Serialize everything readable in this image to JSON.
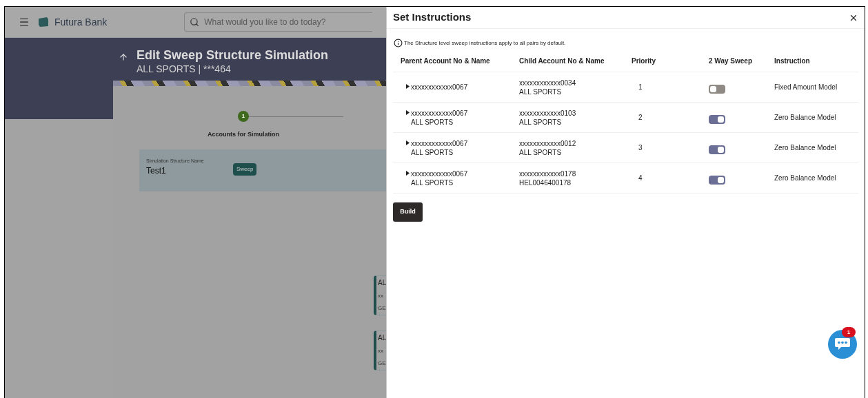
{
  "header": {
    "brand": "Futura Bank",
    "search": {
      "placeholder": "What would you like to do today?"
    }
  },
  "banner": {
    "title": "Edit Sweep Structure Simulation",
    "subtitle": "ALL SPORTS | ***464"
  },
  "stepper": {
    "step_number": "1",
    "step_label": "Accounts for Simulation"
  },
  "structure": {
    "label": "Simulation Structure Name",
    "value": "Test1",
    "tag": "Sweep"
  },
  "account_cards": [
    {
      "lines": [
        "AL",
        "xx",
        "GE"
      ]
    },
    {
      "lines": [
        "AL",
        "xx",
        "GE"
      ]
    }
  ],
  "dialog": {
    "title": "Set Instructions",
    "info": "The Structure level sweep instructions apply to all pairs by default.",
    "columns": [
      "Parent Account No & Name",
      "Child Account No & Name",
      "Priority",
      "2 Way Sweep",
      "Instruction"
    ],
    "rows": [
      {
        "parent": [
          "xxxxxxxxxxxx0067"
        ],
        "child": [
          "xxxxxxxxxxxx0034",
          "ALL SPORTS"
        ],
        "priority": "1",
        "two_way": false,
        "instruction": "Fixed Amount Model"
      },
      {
        "parent": [
          "xxxxxxxxxxxx0067",
          "ALL SPORTS"
        ],
        "child": [
          "xxxxxxxxxxxx0103",
          "ALL SPORTS"
        ],
        "priority": "2",
        "two_way": true,
        "instruction": "Zero Balance Model"
      },
      {
        "parent": [
          "xxxxxxxxxxxx0067",
          "ALL SPORTS"
        ],
        "child": [
          "xxxxxxxxxxxx0012",
          "ALL SPORTS"
        ],
        "priority": "3",
        "two_way": true,
        "instruction": "Zero Balance Model"
      },
      {
        "parent": [
          "xxxxxxxxxxxx0067",
          "ALL SPORTS"
        ],
        "child": [
          "xxxxxxxxxxxx0178",
          "HEL0046400178"
        ],
        "priority": "4",
        "two_way": true,
        "instruction": "Zero Balance Model"
      }
    ],
    "build_button": "Build"
  },
  "chat": {
    "badge": "1"
  }
}
